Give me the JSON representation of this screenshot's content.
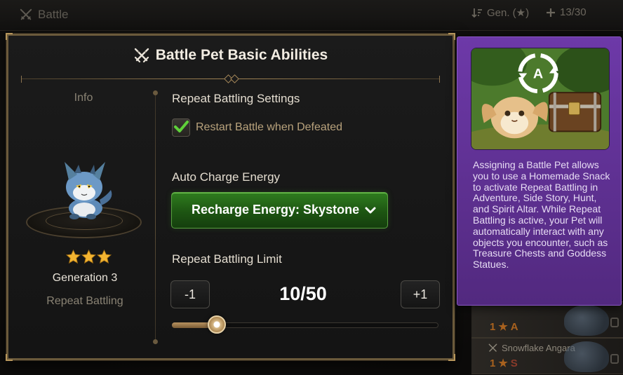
{
  "background": {
    "title": "Battle",
    "sort_label": "Gen. (★)",
    "count": "13/30",
    "list": [
      {
        "name": "",
        "grade": "1",
        "rank": "A"
      },
      {
        "name": "Snowflake Angara",
        "grade": "1",
        "rank": "S"
      }
    ]
  },
  "dialog": {
    "title": "Battle Pet Basic Abilities",
    "info_label": "Info",
    "pet": {
      "stars": 3,
      "generation": "Generation 3",
      "ability": "Repeat Battling"
    },
    "repeat_settings": {
      "heading": "Repeat Battling Settings",
      "restart_label": "Restart Battle when Defeated",
      "restart_checked": true
    },
    "auto_charge": {
      "heading": "Auto Charge Energy",
      "selected": "Recharge Energy: Skystone"
    },
    "limit": {
      "heading": "Repeat Battling Limit",
      "minus_label": "-1",
      "plus_label": "+1",
      "value_text": "10/50",
      "value": 10,
      "max": 50
    }
  },
  "tooltip": {
    "description": "Assigning a Battle Pet allows you to use a Homemade Snack to activate Repeat Battling in Adventure, Side Story, Hunt, and Spirit Altar. While Repeat Battling is active, your Pet will automatically interact with any objects you encounter, such as Treasure Chests and Goddess Statues.",
    "badge_letter": "A"
  },
  "colors": {
    "accent_green": "#2f7d1f",
    "tooltip_purple": "#6d39a8",
    "frame_gold": "#b8975c",
    "star_gold": "#f3b431"
  }
}
